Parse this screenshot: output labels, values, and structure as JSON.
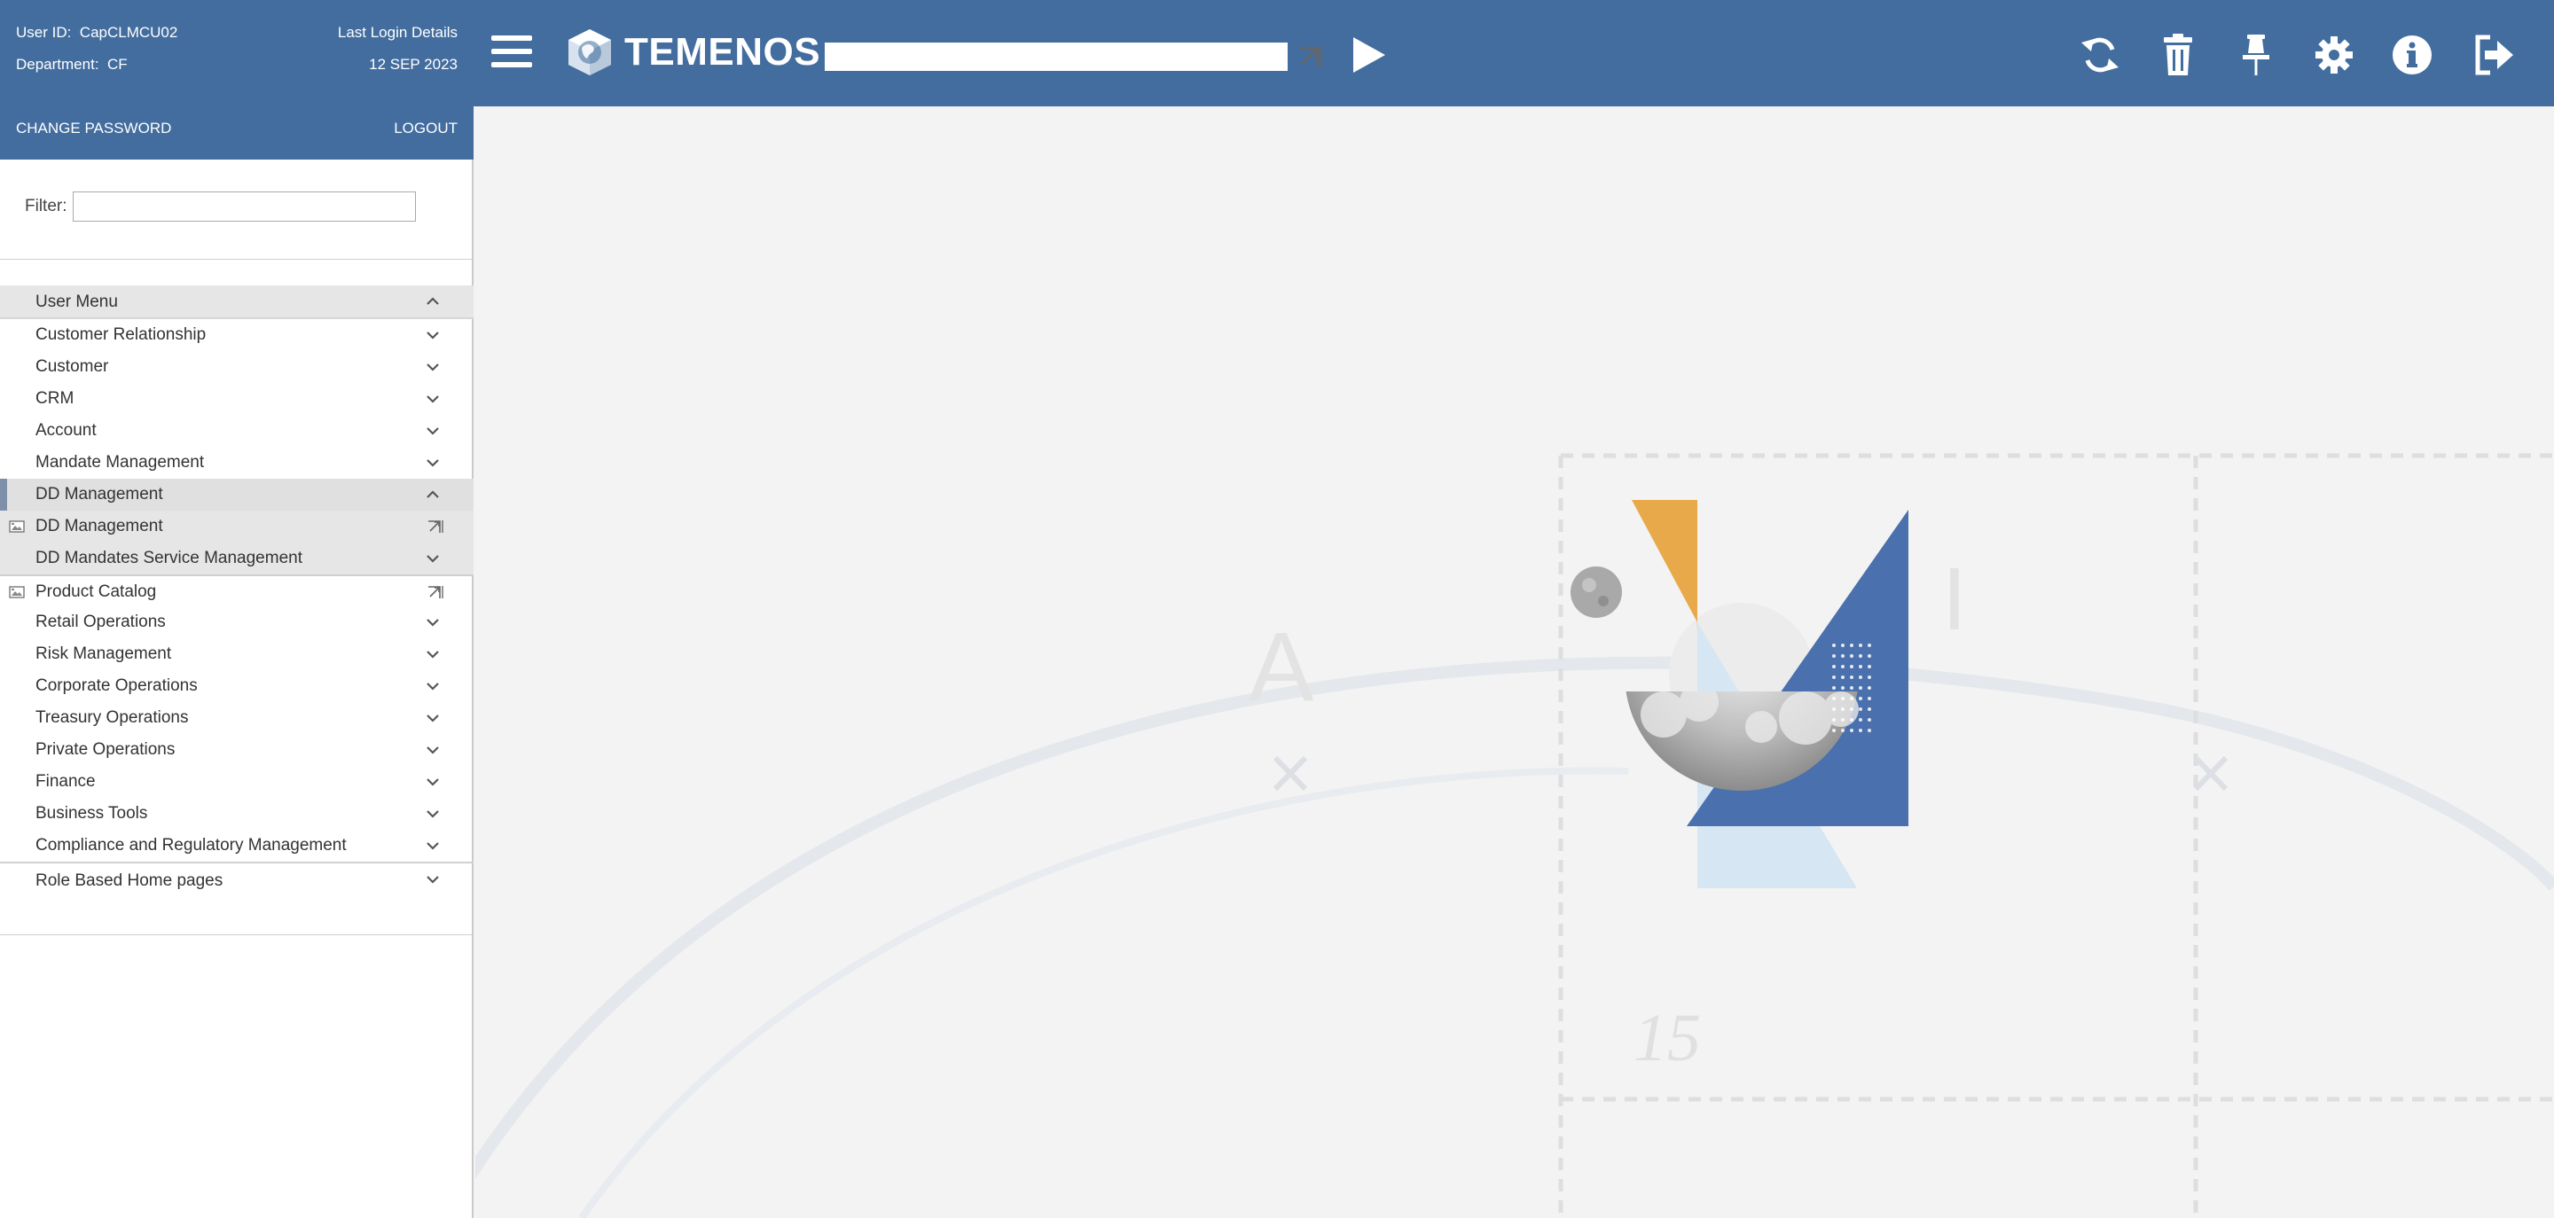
{
  "user_panel": {
    "user_id_label": "User ID:",
    "user_id": "CapCLMCU02",
    "department_label": "Department:",
    "department": "CF",
    "last_login_label": "Last Login Details",
    "last_login_date": "12 SEP 2023",
    "change_password": "CHANGE PASSWORD",
    "logout": "LOGOUT"
  },
  "filter": {
    "label": "Filter:",
    "value": ""
  },
  "menu": [
    {
      "label": "User Menu",
      "state": "expanded",
      "icon": "chevron-up-icon"
    },
    {
      "label": "Customer Relationship",
      "state": "collapsed",
      "icon": "chevron-down-icon"
    },
    {
      "label": "Customer",
      "state": "collapsed",
      "icon": "chevron-down-icon"
    },
    {
      "label": "CRM",
      "state": "collapsed",
      "icon": "chevron-down-icon"
    },
    {
      "label": "Account",
      "state": "collapsed",
      "icon": "chevron-down-icon"
    },
    {
      "label": "Mandate Management",
      "state": "collapsed",
      "icon": "chevron-down-icon"
    },
    {
      "label": "DD Management",
      "state": "expanded-selected",
      "icon": "chevron-up-icon"
    },
    {
      "label": "DD Management",
      "state": "tile-item",
      "icon": "open-new-icon"
    },
    {
      "label": "DD Mandates Service Management",
      "state": "collapsed",
      "icon": "chevron-down-icon"
    },
    {
      "label": "Product Catalog",
      "state": "tile-item",
      "icon": "open-new-icon"
    },
    {
      "label": "Retail Operations",
      "state": "collapsed",
      "icon": "chevron-down-icon"
    },
    {
      "label": "Risk Management",
      "state": "collapsed",
      "icon": "chevron-down-icon"
    },
    {
      "label": "Corporate Operations",
      "state": "collapsed",
      "icon": "chevron-down-icon"
    },
    {
      "label": "Treasury Operations",
      "state": "collapsed",
      "icon": "chevron-down-icon"
    },
    {
      "label": "Private Operations",
      "state": "collapsed",
      "icon": "chevron-down-icon"
    },
    {
      "label": "Finance",
      "state": "collapsed",
      "icon": "chevron-down-icon"
    },
    {
      "label": "Business Tools",
      "state": "collapsed",
      "icon": "chevron-down-icon"
    },
    {
      "label": "Compliance and Regulatory Management",
      "state": "collapsed",
      "icon": "chevron-down-icon"
    },
    {
      "label": "Role Based Home pages",
      "state": "collapsed",
      "icon": "chevron-down-icon"
    }
  ],
  "topbar": {
    "logo_text": "TEMENOS",
    "command_value": "",
    "icons": [
      "menu-icon",
      "refresh-icon",
      "trash-icon",
      "pin-icon",
      "gear-icon",
      "info-icon",
      "sign-out-icon"
    ]
  },
  "background": {
    "letter_a": "A",
    "letter_i": "I",
    "number": "15"
  },
  "colors": {
    "brand_blue": "#426d9e",
    "accent_orange": "#e8a94a",
    "shape_blue": "#4a70ad",
    "light_blue": "#d6e6f3"
  }
}
